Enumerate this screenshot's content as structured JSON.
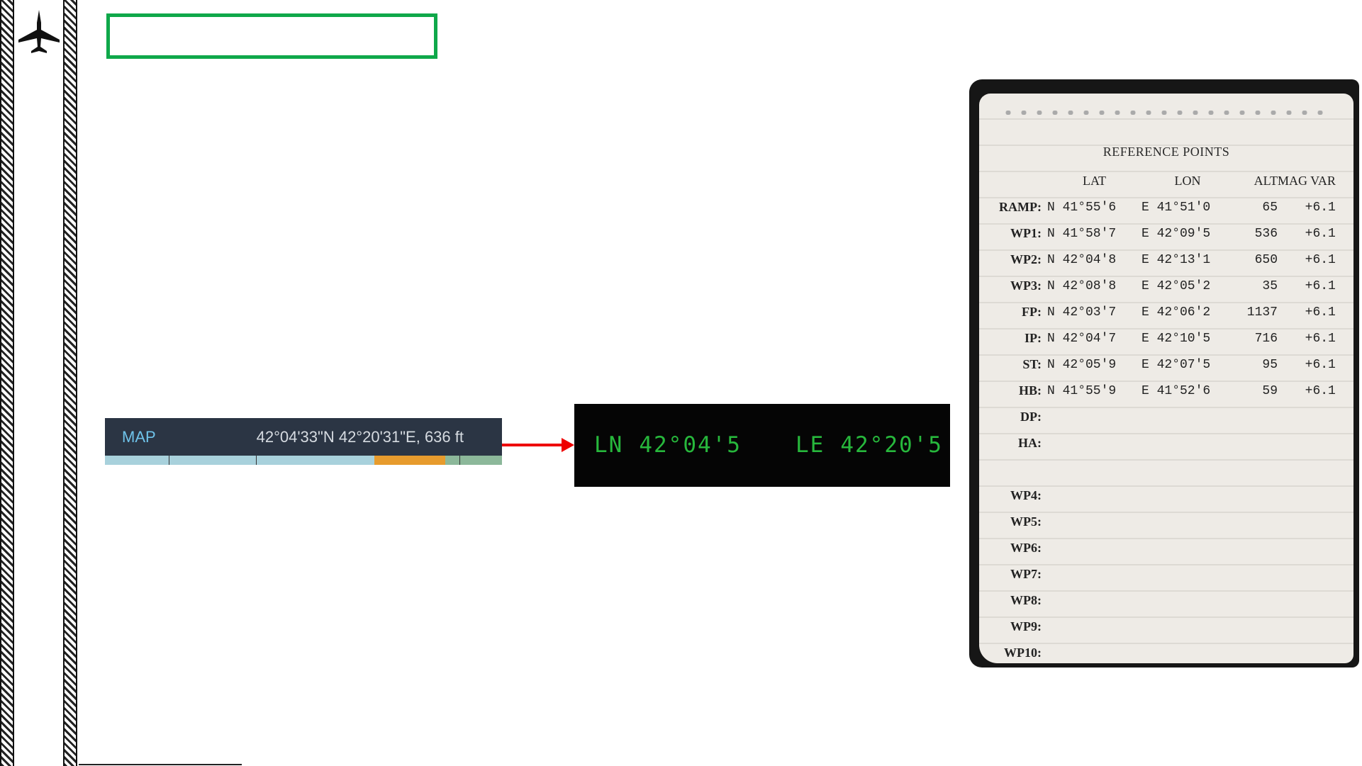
{
  "map_bar": {
    "label": "MAP",
    "coordinates": "42°04'33\"N 42°20'31\"E, 636 ft"
  },
  "cockpit_display": {
    "lat_prefix": "LN",
    "lat_value": "42°04'5",
    "lon_prefix": "LE",
    "lon_value": "42°20'5",
    "text_color": "#27b83c"
  },
  "notepad": {
    "title": "REFERENCE POINTS",
    "headers": {
      "lat": "LAT",
      "lon": "LON",
      "alt": "ALT",
      "mag": "MAG VAR"
    },
    "rows": [
      {
        "label": "RAMP:",
        "lat": "N 41°55'6",
        "lon": "E 41°51'0",
        "alt": "65",
        "mag": "+6.1"
      },
      {
        "label": "WP1:",
        "lat": "N 41°58'7",
        "lon": "E 42°09'5",
        "alt": "536",
        "mag": "+6.1"
      },
      {
        "label": "WP2:",
        "lat": "N 42°04'8",
        "lon": "E 42°13'1",
        "alt": "650",
        "mag": "+6.1"
      },
      {
        "label": "WP3:",
        "lat": "N 42°08'8",
        "lon": "E 42°05'2",
        "alt": "35",
        "mag": "+6.1"
      },
      {
        "label": "FP:",
        "lat": "N 42°03'7",
        "lon": "E 42°06'2",
        "alt": "1137",
        "mag": "+6.1"
      },
      {
        "label": "IP:",
        "lat": "N 42°04'7",
        "lon": "E 42°10'5",
        "alt": "716",
        "mag": "+6.1"
      },
      {
        "label": "ST:",
        "lat": "N 42°05'9",
        "lon": "E 42°07'5",
        "alt": "95",
        "mag": "+6.1"
      },
      {
        "label": "HB:",
        "lat": "N 41°55'9",
        "lon": "E 41°52'6",
        "alt": "59",
        "mag": "+6.1"
      },
      {
        "label": "DP:",
        "lat": "",
        "lon": "",
        "alt": "",
        "mag": ""
      },
      {
        "label": "HA:",
        "lat": "",
        "lon": "",
        "alt": "",
        "mag": ""
      }
    ],
    "rows2": [
      {
        "label": "WP4:"
      },
      {
        "label": "WP5:"
      },
      {
        "label": "WP6:"
      },
      {
        "label": "WP7:"
      },
      {
        "label": "WP8:"
      },
      {
        "label": "WP9:"
      },
      {
        "label": "WP10:"
      }
    ]
  },
  "colors": {
    "title_box_border": "#0fa84a",
    "arrow": "#e00000",
    "map_label": "#6fc3ea"
  }
}
